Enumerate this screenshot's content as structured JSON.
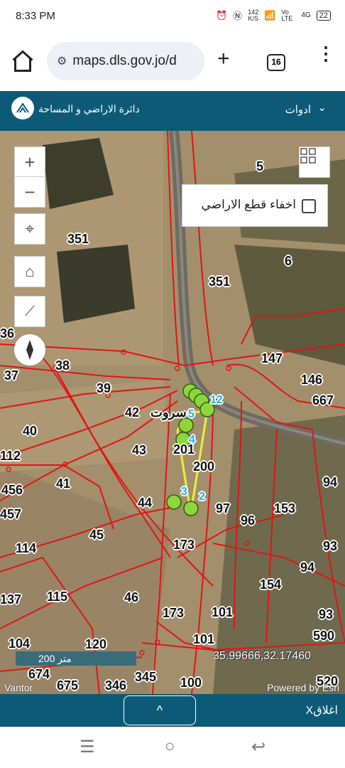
{
  "status_bar": {
    "time": "8:33 PM",
    "net_speed_value": "142",
    "net_speed_unit": "K/S",
    "volte": "Vo LTE",
    "network": "4G",
    "battery": "22"
  },
  "browser": {
    "url": "maps.dls.gov.jo/d",
    "tab_count": "16"
  },
  "header": {
    "agency": "دائرة الاراضي و المساحة",
    "tools_label": "ادوات"
  },
  "map": {
    "hide_parcels_label": "اخفاء قطع الاراضي",
    "parcel_labels": [
      "5",
      "351",
      "6",
      "351",
      "36",
      "147",
      "37",
      "38",
      "146",
      "39",
      "667",
      "42",
      "40",
      "43",
      "112",
      "200",
      "94",
      "456",
      "41",
      "457",
      "44",
      "97",
      "153",
      "96",
      "45",
      "173",
      "93",
      "114",
      "94",
      "154",
      "137",
      "115",
      "46",
      "173",
      "101",
      "93",
      "590",
      "101",
      "104",
      "120",
      "674",
      "675",
      "346",
      "345",
      "100",
      "520",
      "201",
      "سروت"
    ],
    "point_labels": [
      "2",
      "3",
      "4",
      "5",
      "12"
    ],
    "scale_label": "200 متر",
    "coordinates": "35.99666,32.17460",
    "attribution_left": "Vantor",
    "attribution_right": "Powered by Esri"
  },
  "bottom": {
    "collapse_label": "^",
    "close_label": "Xاغلاق"
  }
}
